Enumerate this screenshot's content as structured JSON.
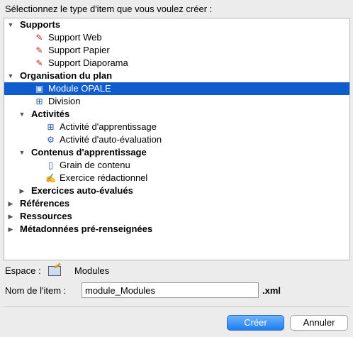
{
  "prompt": "Sélectionnez le type d'item que vous voulez créer :",
  "tree": [
    {
      "label": "Supports",
      "bold": true,
      "expanded": true,
      "icon": ""
    },
    {
      "label": "Support Web",
      "icon": "support-web-icon"
    },
    {
      "label": "Support Papier",
      "icon": "support-paper-icon"
    },
    {
      "label": "Support Diaporama",
      "icon": "support-slides-icon"
    },
    {
      "label": "Organisation du plan",
      "bold": true,
      "expanded": true,
      "icon": ""
    },
    {
      "label": "Module OPALE",
      "icon": "module-icon",
      "selected": true
    },
    {
      "label": "Division",
      "icon": "division-icon"
    },
    {
      "label": "Activités",
      "bold": true,
      "expanded": true,
      "icon": ""
    },
    {
      "label": "Activité d'apprentissage",
      "icon": "learning-activity-icon"
    },
    {
      "label": "Activité d'auto-évaluation",
      "icon": "self-assessment-icon"
    },
    {
      "label": "Contenus d'apprentissage",
      "bold": true,
      "expanded": true,
      "icon": ""
    },
    {
      "label": "Grain de contenu",
      "icon": "content-grain-icon"
    },
    {
      "label": "Exercice rédactionnel",
      "icon": "writing-exercise-icon"
    },
    {
      "label": "Exercices auto-évalués",
      "bold": true,
      "expanded": false,
      "icon": ""
    },
    {
      "label": "Références",
      "bold": true,
      "expanded": false,
      "icon": ""
    },
    {
      "label": "Ressources",
      "bold": true,
      "expanded": false,
      "icon": ""
    },
    {
      "label": "Métadonnées pré-renseignées",
      "bold": true,
      "expanded": false,
      "icon": ""
    }
  ],
  "space": {
    "label": "Espace :",
    "value": "Modules",
    "icon": "space-edit-icon"
  },
  "name": {
    "label": "Nom de l'item :",
    "value": "module_Modules",
    "extension": ".xml"
  },
  "buttons": {
    "create": "Créer",
    "cancel": "Annuler"
  },
  "colors": {
    "selection": "#0f5ccf",
    "primary_button": "#1f7df1"
  }
}
